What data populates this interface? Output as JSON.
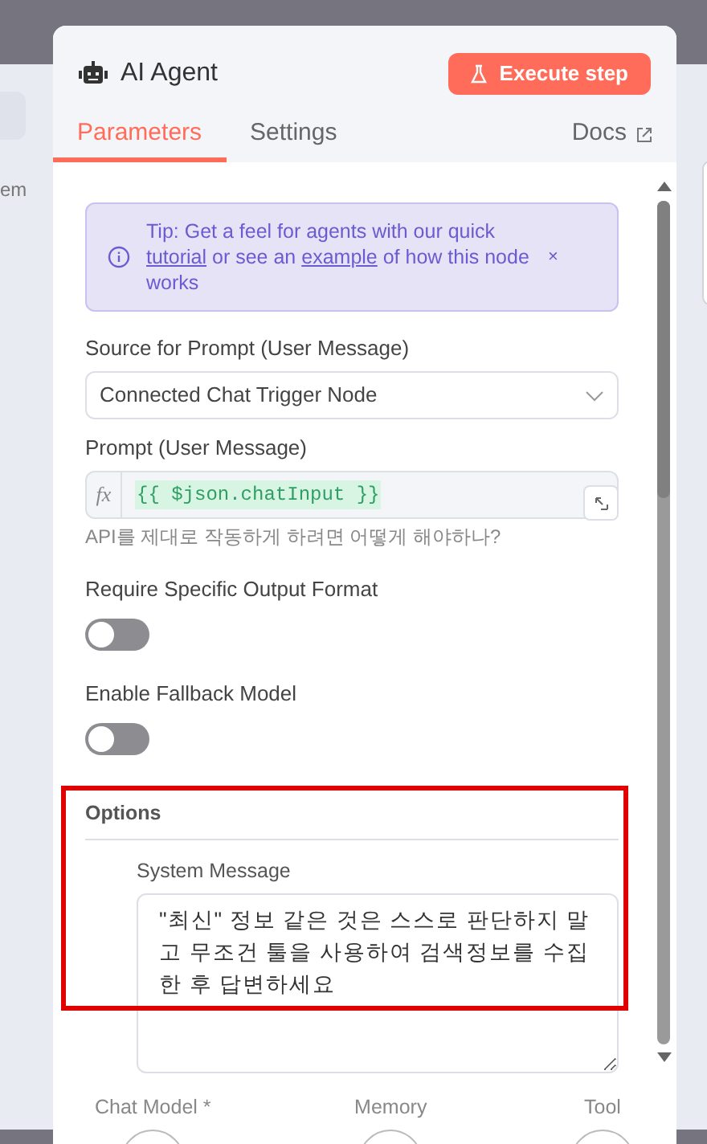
{
  "background": {
    "side_text": "em"
  },
  "panel": {
    "title": "AI Agent",
    "execute_button": "Execute step",
    "tabs": [
      {
        "label": "Parameters",
        "selected": true
      },
      {
        "label": "Settings",
        "selected": false
      }
    ],
    "docs_link": "Docs",
    "tip": {
      "text": "Tip: Get a feel for agents with our quick",
      "link_1": "tutorial",
      "middle": "or see an",
      "link_2": "example",
      "end": "of how this node works",
      "close": "×"
    },
    "fields": [
      {
        "kind": "select",
        "label": "Source for Prompt (User Message)",
        "value": "Connected Chat Trigger Node"
      },
      {
        "kind": "expression",
        "label": "Prompt (User Message)",
        "fx": "fx",
        "value": "{{ $json.chatInput }}",
        "hint": "API를 제대로 작동하게 하려면 어떻게 해야하나?"
      },
      {
        "kind": "toggle",
        "label": "Require Specific Output Format",
        "on": false
      },
      {
        "kind": "toggle",
        "label": "Enable Fallback Model",
        "on": false
      }
    ],
    "options": {
      "title": "Options",
      "system_message_label": "System Message",
      "system_message": "\"최신\" 정보 같은 것은 스스로 판단하지 말고 무조건 툴을 사용하여 검색정보를 수집한 후 답변하세요"
    },
    "connectors": [
      "Chat Model *",
      "Memory",
      "Tool"
    ]
  }
}
